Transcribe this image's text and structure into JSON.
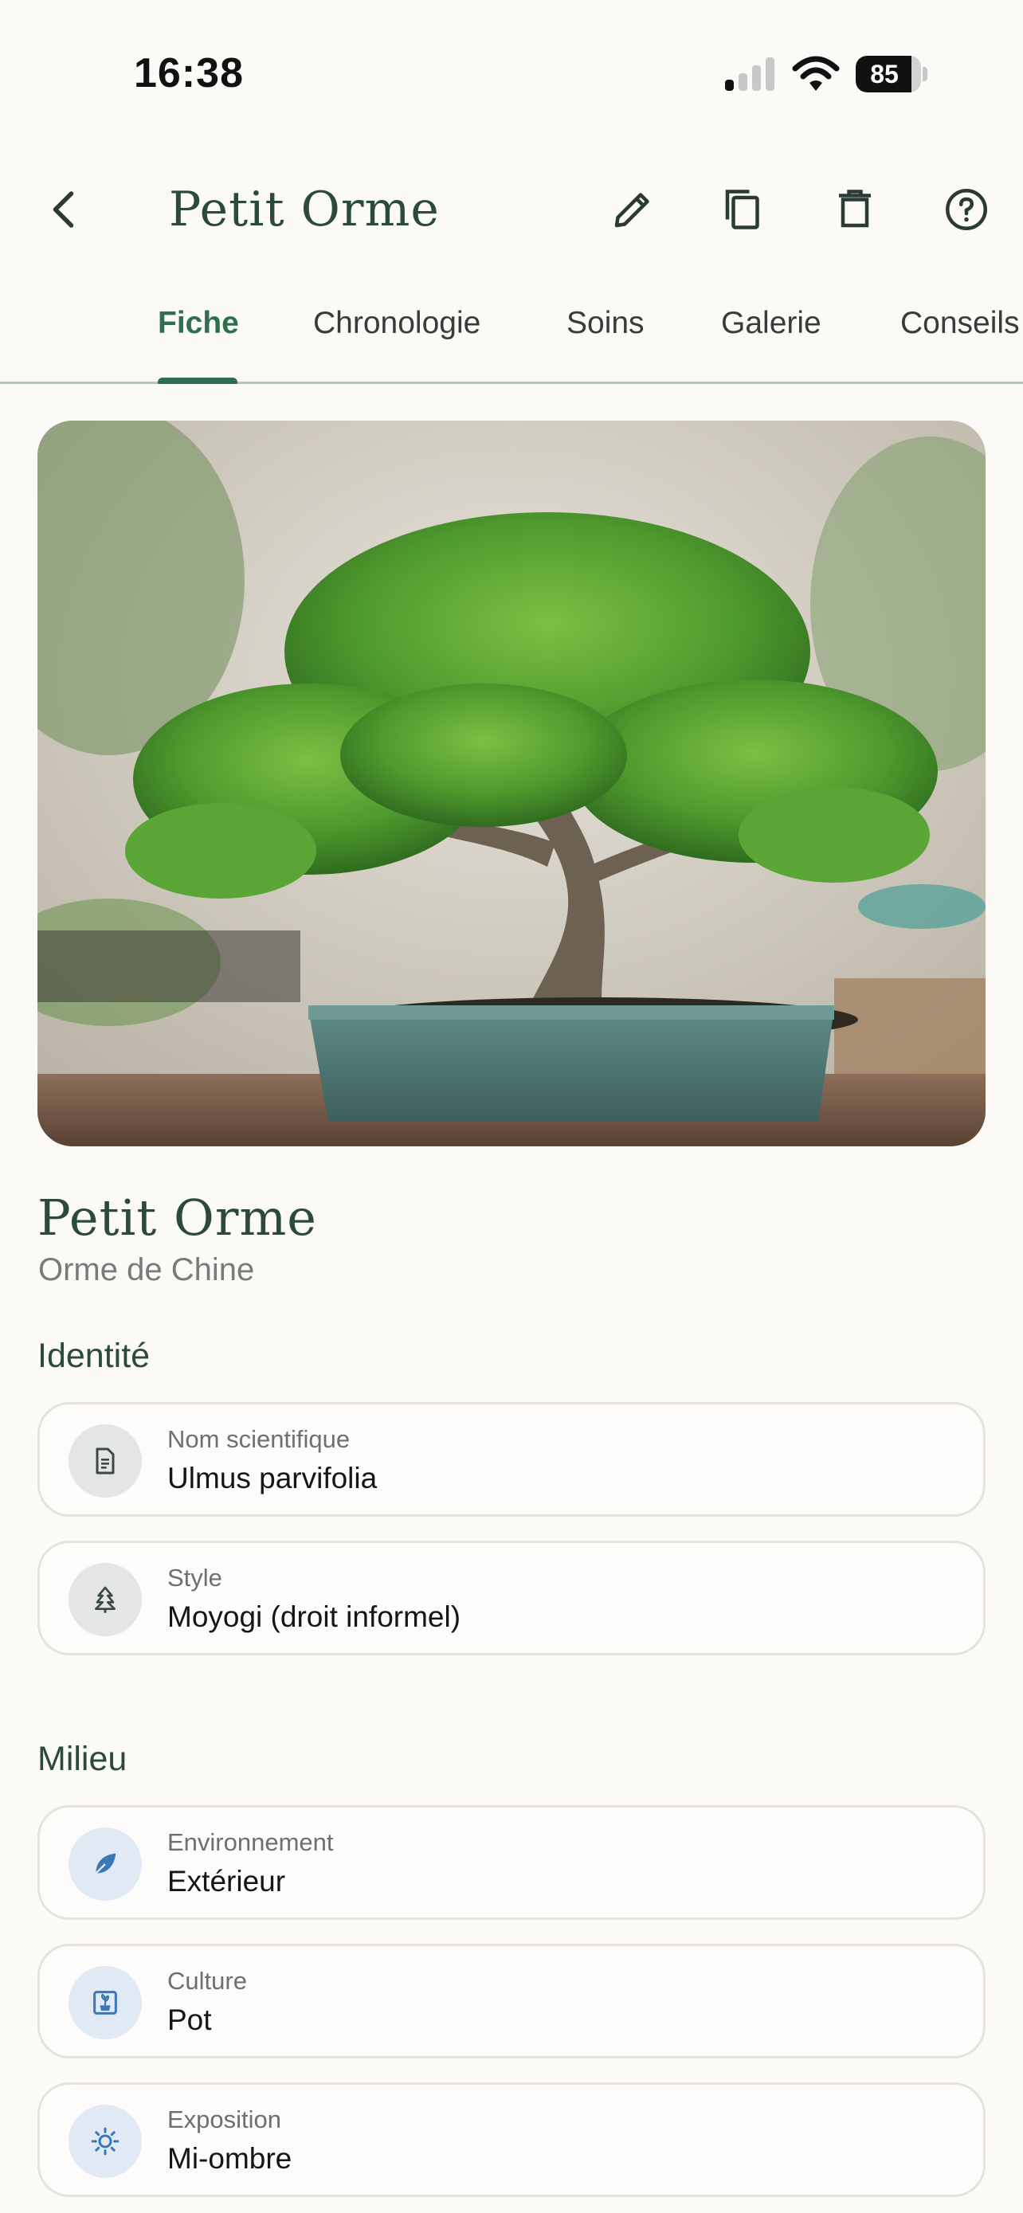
{
  "status_bar": {
    "time": "16:38",
    "battery_level": "85",
    "signal_bars_active": 1,
    "signal_bars_total": 4
  },
  "app_bar": {
    "title": "Petit Orme",
    "icons": [
      "back-arrow-icon",
      "edit-pencil-icon",
      "duplicate-icon",
      "delete-trash-icon",
      "help-icon"
    ]
  },
  "tabs": [
    {
      "label": "Fiche",
      "active": true
    },
    {
      "label": "Chronologie",
      "active": false
    },
    {
      "label": "Soins",
      "active": false
    },
    {
      "label": "Galerie",
      "active": false
    },
    {
      "label": "Conseils",
      "active": false
    }
  ],
  "plant": {
    "name": "Petit Orme",
    "species": "Orme de Chine"
  },
  "sections": {
    "identity": {
      "title": "Identité",
      "cards": [
        {
          "label": "Nom scientifique",
          "value": "Ulmus parvifolia",
          "icon": "document-icon"
        },
        {
          "label": "Style",
          "value": "Moyogi (droit informel)",
          "icon": "tree-icon"
        }
      ]
    },
    "environment": {
      "title": "Milieu",
      "cards": [
        {
          "label": "Environnement",
          "value": "Extérieur",
          "icon": "leaf-icon"
        },
        {
          "label": "Culture",
          "value": "Pot",
          "icon": "pot-icon"
        },
        {
          "label": "Exposition",
          "value": "Mi-ombre",
          "icon": "sun-icon"
        }
      ]
    }
  },
  "colors": {
    "accent": "#2e6f4f",
    "title_green": "#2b4a3c",
    "background": "#fbfaf7",
    "icon_blue": "#3a78b8"
  }
}
